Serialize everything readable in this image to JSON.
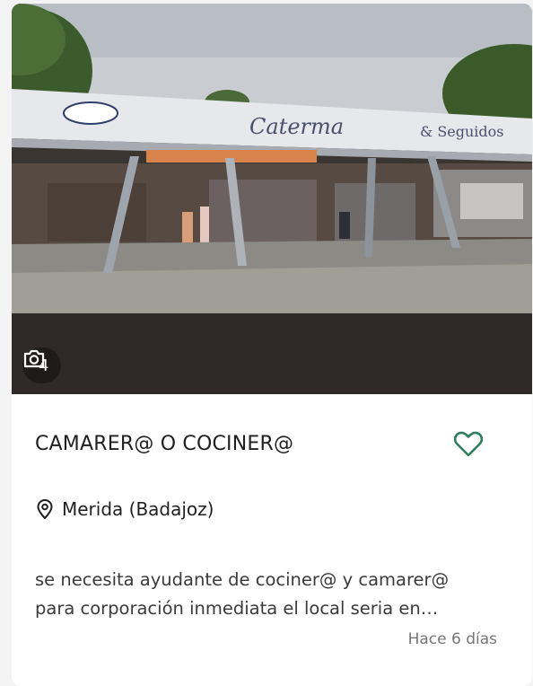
{
  "listing": {
    "photo_count": "4",
    "title": "CAMARER@ O COCINER@",
    "location": "Merida (Badajoz)",
    "description_line1": "se necesita ayudante de cociner@ y camarer@",
    "description_line2": "para corporación inmediata el local seria en…",
    "posted": "Hace 6 días",
    "icons": {
      "camera": "camera-icon",
      "favorite": "heart-outline-icon",
      "location": "map-pin-icon"
    },
    "colors": {
      "favorite": "#2e7d5b",
      "text": "#1f1f1f",
      "muted": "#767676"
    }
  }
}
